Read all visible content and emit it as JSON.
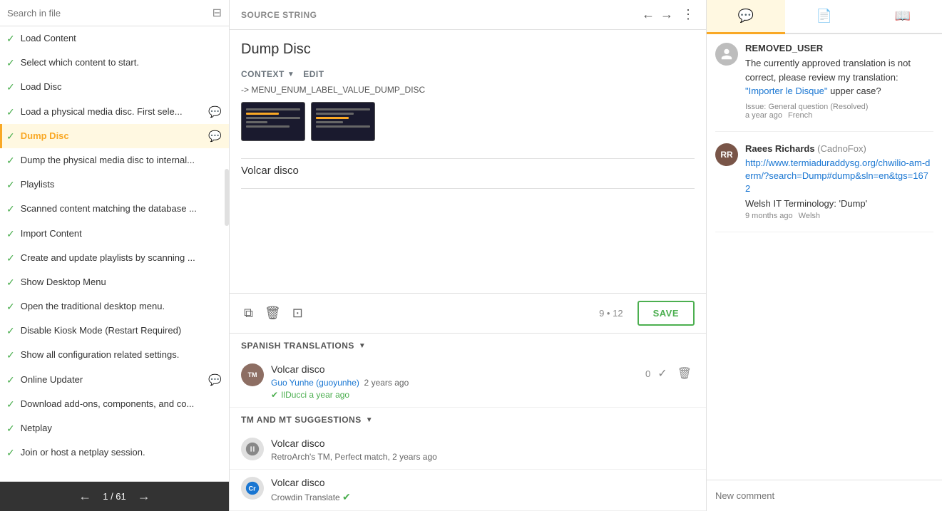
{
  "left_panel": {
    "search_placeholder": "Search in file",
    "filter_icon": "≡",
    "items": [
      {
        "id": "load-content",
        "text": "Load Content",
        "checked": true,
        "active": false,
        "comment": false
      },
      {
        "id": "select-content",
        "text": "Select which content to start.",
        "checked": true,
        "active": false,
        "comment": false
      },
      {
        "id": "load-disc",
        "text": "Load Disc",
        "checked": true,
        "active": false,
        "comment": false
      },
      {
        "id": "load-physical",
        "text": "Load a physical media disc. First sele...",
        "checked": true,
        "active": false,
        "comment_gray": true
      },
      {
        "id": "dump-disc",
        "text": "Dump Disc",
        "checked": true,
        "active": true,
        "comment": true
      },
      {
        "id": "dump-physical",
        "text": "Dump the physical media disc to internal...",
        "checked": true,
        "active": false,
        "comment": false
      },
      {
        "id": "playlists",
        "text": "Playlists",
        "checked": true,
        "active": false,
        "comment": false
      },
      {
        "id": "scanned-content",
        "text": "Scanned content matching the database ...",
        "checked": true,
        "active": false,
        "comment": false
      },
      {
        "id": "import-content",
        "text": "Import Content",
        "checked": true,
        "active": false,
        "comment": false
      },
      {
        "id": "create-playlists",
        "text": "Create and update playlists by scanning ...",
        "checked": true,
        "active": false,
        "comment": false
      },
      {
        "id": "show-desktop-menu",
        "text": "Show Desktop Menu",
        "checked": true,
        "active": false,
        "comment": false
      },
      {
        "id": "open-desktop",
        "text": "Open the traditional desktop menu.",
        "checked": true,
        "active": false,
        "comment": false
      },
      {
        "id": "disable-kiosk",
        "text": "Disable Kiosk Mode (Restart Required)",
        "checked": true,
        "active": false,
        "comment": false
      },
      {
        "id": "show-config",
        "text": "Show all configuration related settings.",
        "checked": true,
        "active": false,
        "comment": false
      },
      {
        "id": "online-updater",
        "text": "Online Updater",
        "checked": true,
        "active": false,
        "comment_gray": true
      },
      {
        "id": "download-addons",
        "text": "Download add-ons, components, and co...",
        "checked": true,
        "active": false,
        "comment": false
      },
      {
        "id": "netplay",
        "text": "Netplay",
        "checked": true,
        "active": false,
        "comment": false
      },
      {
        "id": "join-netplay",
        "text": "Join or host a netplay session.",
        "checked": true,
        "active": false,
        "comment": false
      }
    ],
    "pagination": {
      "current": 1,
      "total": 61,
      "label": "1 / 61"
    }
  },
  "middle_panel": {
    "source_string_label": "SOURCE STRING",
    "dump_disc_title": "Dump Disc",
    "context_label": "CONTEXT",
    "edit_label": "EDIT",
    "context_path": "-> MENU_ENUM_LABEL_VALUE_DUMP_DISC",
    "translation_text": "Volcar disco",
    "char_count": "9 • 12",
    "save_label": "SAVE",
    "spanish_translations_label": "SPANISH TRANSLATIONS",
    "translations": [
      {
        "id": "trans-1",
        "text": "Volcar disco",
        "author": "Guo Yunhe (guoyunhe)",
        "time": "2 years ago",
        "verified_by": "IlDucci",
        "verified_time": "a year ago",
        "votes": "0"
      }
    ],
    "tm_suggestions_label": "TM AND MT SUGGESTIONS",
    "suggestions": [
      {
        "id": "sug-1",
        "text": "Volcar disco",
        "source": "RetroArch's TM, Perfect match, 2 years ago"
      },
      {
        "id": "sug-2",
        "text": "Volcar disco",
        "source": "Crowdin Translate",
        "verified": true
      }
    ]
  },
  "right_panel": {
    "tabs": [
      {
        "id": "comments",
        "icon": "💬",
        "active": true
      },
      {
        "id": "info",
        "icon": "📄",
        "active": false
      },
      {
        "id": "bookmark",
        "icon": "📖",
        "active": false
      }
    ],
    "comments": [
      {
        "id": "comment-1",
        "author": "REMOVED_USER",
        "avatar_text": "👤",
        "text_parts": [
          {
            "text": "The currently approved translation is not correct, please review my translation: ",
            "highlight": false
          },
          {
            "text": "\"Importer le Disque\"",
            "highlight": true
          },
          {
            "text": " upper case?",
            "highlight": false
          }
        ],
        "issue": "Issue: General question (Resolved)",
        "time": "a year ago",
        "language": "French"
      },
      {
        "id": "comment-2",
        "author": "Raees Richards",
        "author_handle": "(CadnoFox)",
        "avatar_text": "RR",
        "link": "http://www.termiaduraddysg.org/chwilio-am-derm/?search=Dump#dump&sln=en&tgs=1672",
        "ref_text": "Welsh IT Terminology: 'Dump'",
        "time": "9 months ago",
        "language": "Welsh"
      }
    ],
    "new_comment_placeholder": "New comment"
  }
}
